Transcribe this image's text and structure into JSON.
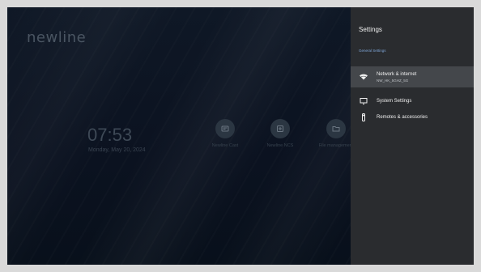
{
  "brand": "newline",
  "home": {
    "time": "07:53",
    "date": "Monday, May 20, 2024",
    "apps": [
      {
        "label": "Newline Cast",
        "icon": "cast-icon"
      },
      {
        "label": "Newline NCS",
        "icon": "ncs-icon"
      },
      {
        "label": "File management",
        "icon": "folder-icon"
      }
    ]
  },
  "settings": {
    "title": "Settings",
    "section": "General Settings",
    "items": [
      {
        "label": "Network & internet",
        "sub": "NW_HK_5GHZ_5G",
        "icon": "wifi-icon"
      },
      {
        "label": "System Settings",
        "icon": "monitor-icon"
      },
      {
        "label": "Remotes & accessories",
        "icon": "remote-icon"
      }
    ]
  },
  "colors": {
    "screen_bg": "#0c1420",
    "panel_bg": "#2a2c2f",
    "accent": "#7fa6d8"
  }
}
